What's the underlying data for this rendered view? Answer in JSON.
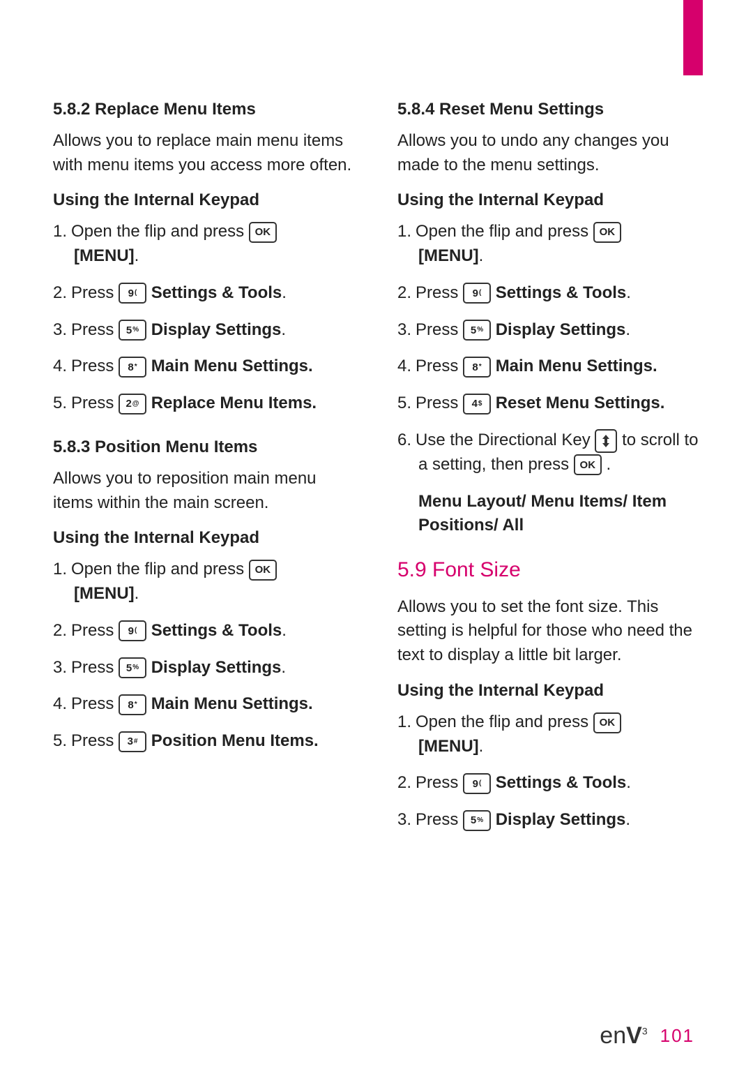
{
  "footer": {
    "brand": "enV",
    "brand_sup": "3",
    "page": "101"
  },
  "kOK": "OK",
  "s582": {
    "h": "5.8.2 Replace Menu Items",
    "p": "Allows you to replace main menu items with menu items you access more often.",
    "sub": "Using the Internal Keypad",
    "l1a": "Open the flip and press ",
    "l1b": "[MENU]",
    "l2a": "Press ",
    "l2b": "Settings & Tools",
    "l3a": "Press ",
    "l3b": "Display Settings",
    "l4a": "Press ",
    "l4b": "Main Menu Settings.",
    "l5a": "Press ",
    "l5b": "Replace Menu Items."
  },
  "s583": {
    "h": "5.8.3 Position Menu Items",
    "p": "Allows you to reposition main menu items within the main screen.",
    "sub": "Using the Internal Keypad",
    "l1a": "Open the flip and press ",
    "l1b": "[MENU]",
    "l2a": "Press ",
    "l2b": "Settings & Tools",
    "l3a": "Press ",
    "l3b": "Display Settings",
    "l4a": "Press ",
    "l4b": "Main Menu Settings.",
    "l5a": "Press ",
    "l5b": "Position Menu Items."
  },
  "s584": {
    "h": "5.8.4 Reset Menu Settings",
    "p": "Allows you to undo any changes you made to the menu settings.",
    "sub": "Using the Internal Keypad",
    "l1a": "Open the flip and press ",
    "l1b": "[MENU]",
    "l2a": "Press ",
    "l2b": "Settings & Tools",
    "l3a": "Press ",
    "l3b": "Display Settings",
    "l4a": "Press ",
    "l4b": "Main Menu Settings.",
    "l5a": "Press ",
    "l5b": "Reset Menu Settings.",
    "l6a": "Use the Directional Key ",
    "l6b": " to scroll to a setting, then press ",
    "l7": "Menu Layout/ Menu Items/ Item Positions/ All"
  },
  "s59": {
    "h": "5.9 Font Size",
    "p": "Allows you to set the font size. This setting is helpful for those who need the text to display a little bit larger.",
    "sub": "Using the Internal Keypad",
    "l1a": "Open the flip and press ",
    "l1b": "[MENU]",
    "l2a": "Press ",
    "l2b": "Settings & Tools",
    "l3a": "Press ",
    "l3b": "Display Settings"
  },
  "keys": {
    "k2": "2",
    "k2s": "@",
    "k3": "3",
    "k3s": "#",
    "k4": "4",
    "k4s": "$",
    "k5": "5",
    "k5s": "%",
    "k8": "8",
    "k8s": "*",
    "k9": "9",
    "k9s": "("
  }
}
